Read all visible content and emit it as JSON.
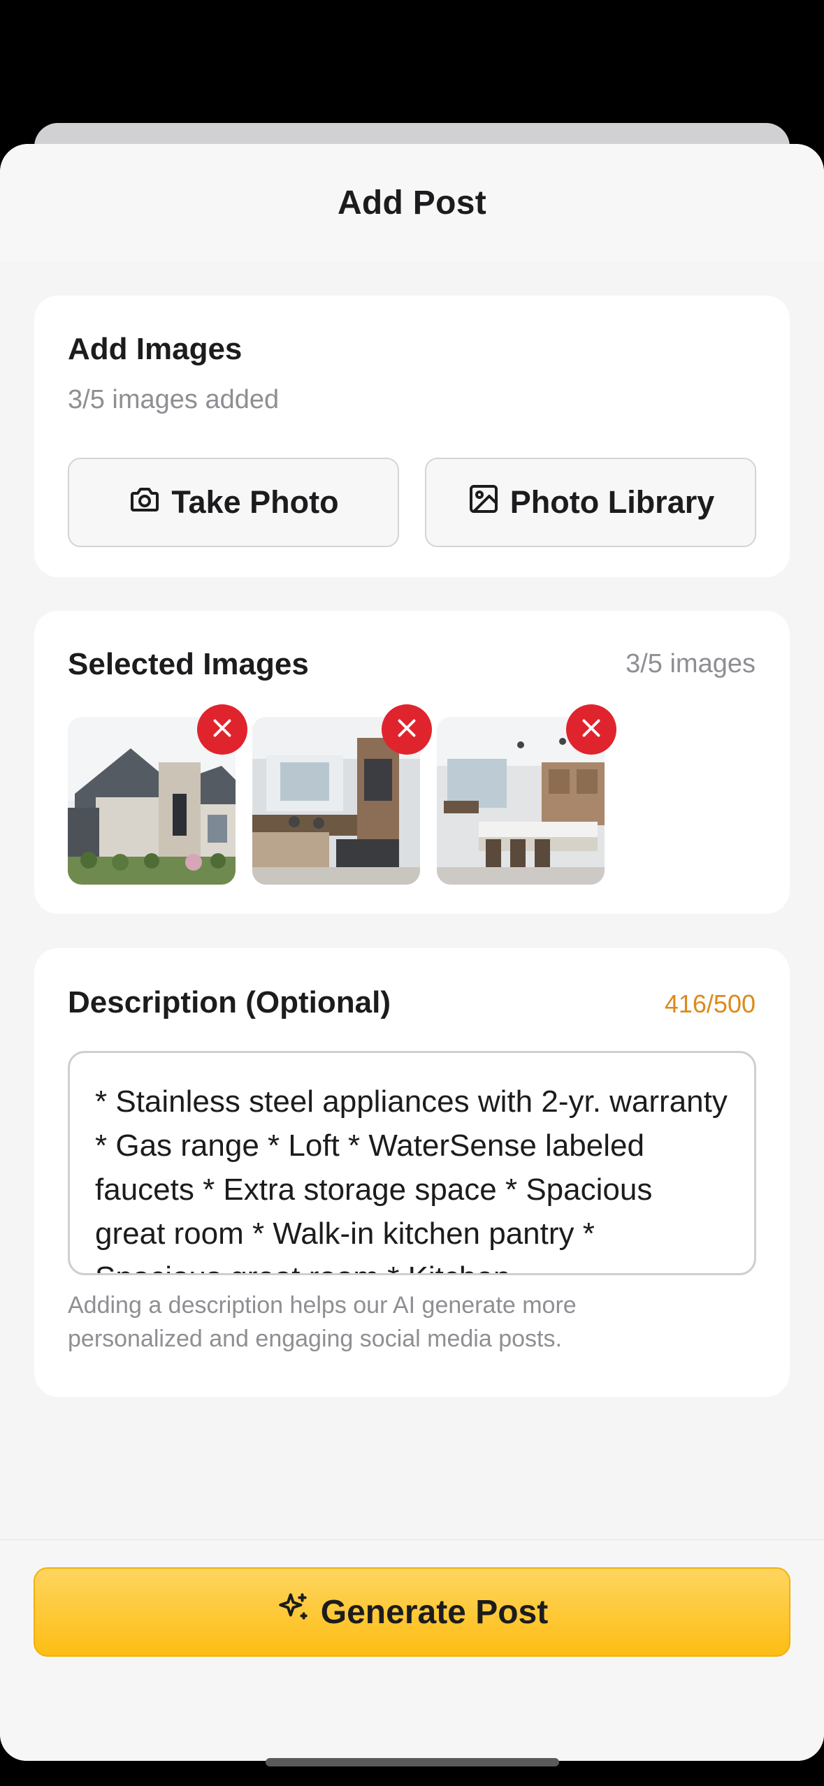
{
  "sheet": {
    "title": "Add Post"
  },
  "add_images": {
    "heading": "Add Images",
    "count_text": "3/5 images added",
    "take_photo_label": "Take Photo",
    "photo_library_label": "Photo Library"
  },
  "selected_images": {
    "heading": "Selected Images",
    "count_text": "3/5 images",
    "items": [
      {
        "subject": "house exterior"
      },
      {
        "subject": "kitchen interior"
      },
      {
        "subject": "kitchen and dining interior"
      }
    ]
  },
  "description": {
    "heading": "Description (Optional)",
    "counter": "416/500",
    "value": "* Stainless steel appliances with 2-yr. warranty * Gas range * Loft * WaterSense labeled faucets * Extra storage space * Spacious great room * Walk-in kitchen pantry * Spacious great room * Kitchen",
    "hint": "Adding a description helps our AI generate more personalized and engaging social media posts."
  },
  "footer": {
    "generate_label": "Generate Post"
  },
  "colors": {
    "accent": "#FDBD13",
    "remove": "#E0242D",
    "counter": "#DC8A1C"
  }
}
